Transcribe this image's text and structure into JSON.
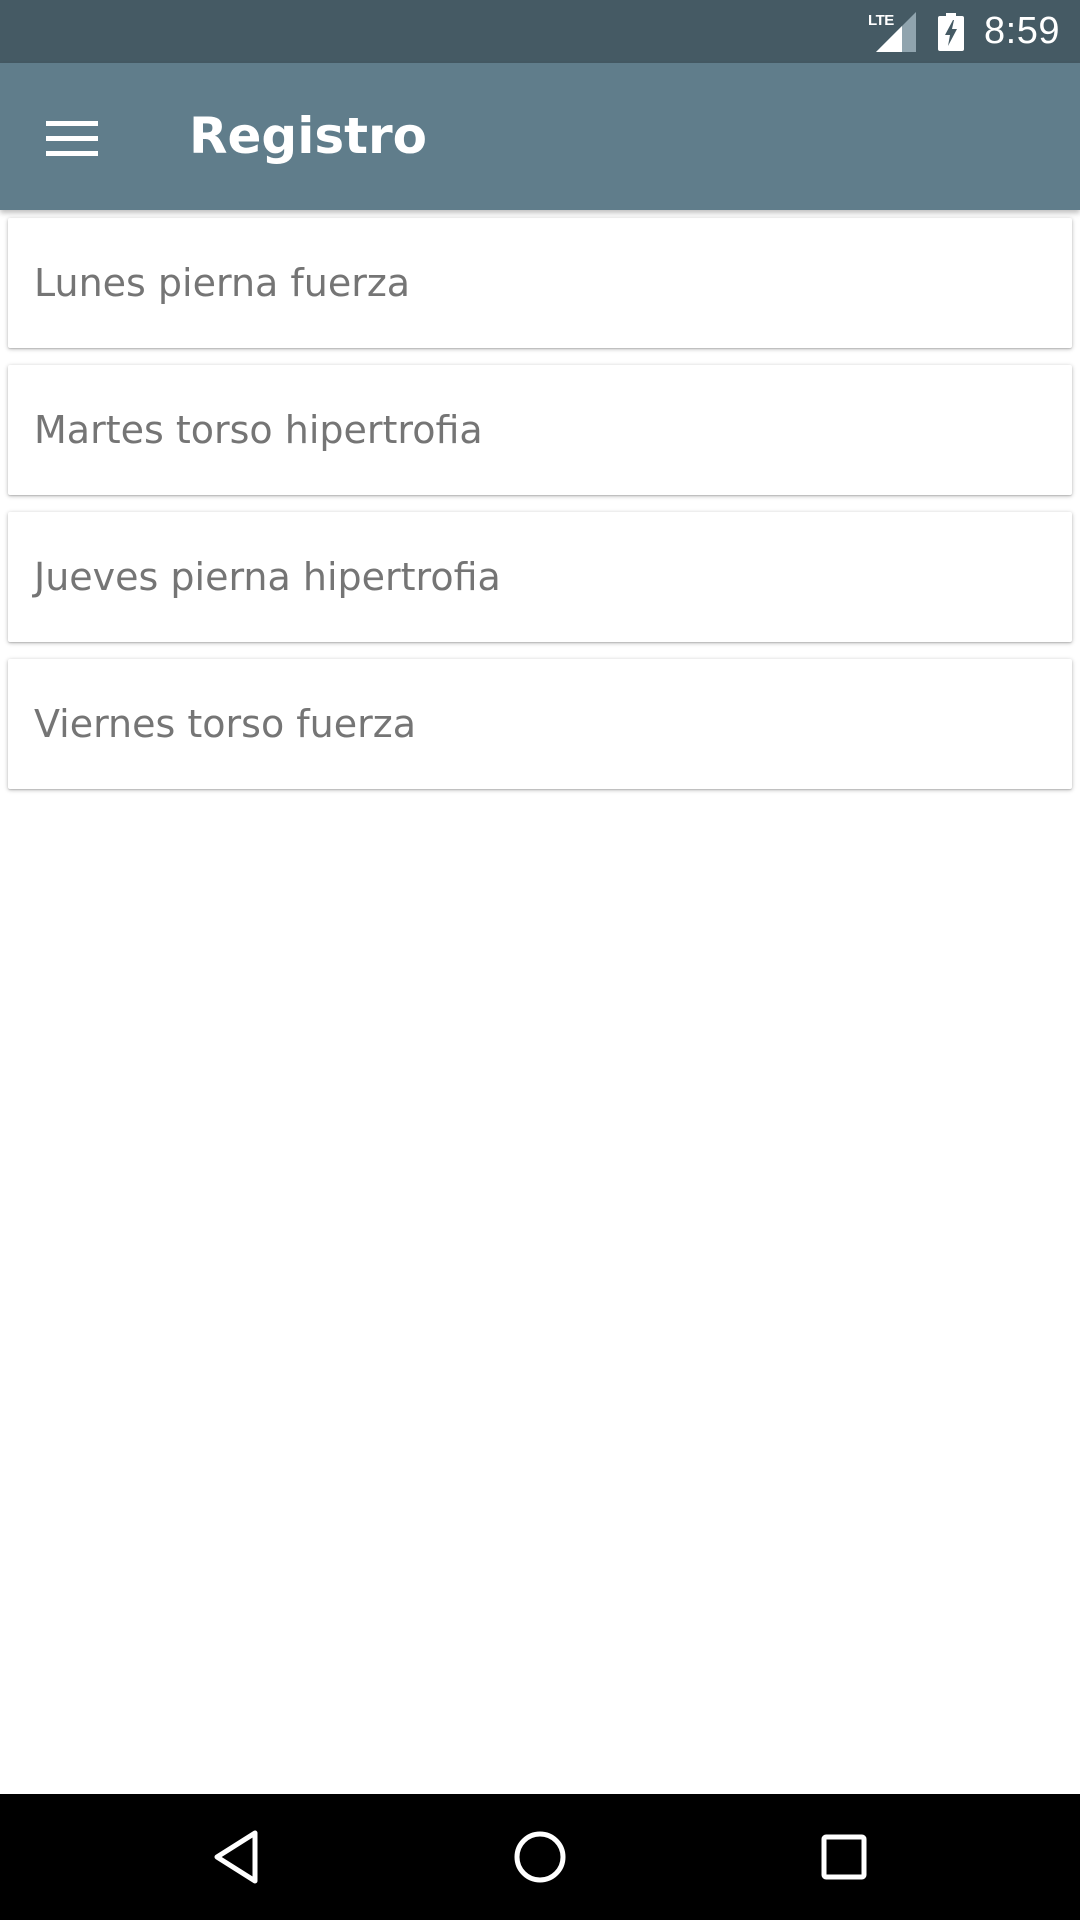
{
  "status_bar": {
    "network_label": "LTE",
    "time": "8:59",
    "icons": [
      "signal-icon",
      "battery-charging-icon"
    ]
  },
  "app_bar": {
    "title": "Registro",
    "menu_icon": "menu-icon",
    "background_color": "#607d8b"
  },
  "routines": [
    {
      "label": "Lunes pierna fuerza"
    },
    {
      "label": "Martes torso hipertrofia"
    },
    {
      "label": "Jueves pierna hipertrofia"
    },
    {
      "label": "Viernes torso fuerza"
    }
  ],
  "nav_bar": {
    "icons": [
      "back-icon",
      "home-icon",
      "recents-icon"
    ]
  },
  "colors": {
    "status_bar": "#455a64",
    "app_bar": "#607d8b",
    "list_text": "#757575",
    "nav_bar": "#000000"
  }
}
